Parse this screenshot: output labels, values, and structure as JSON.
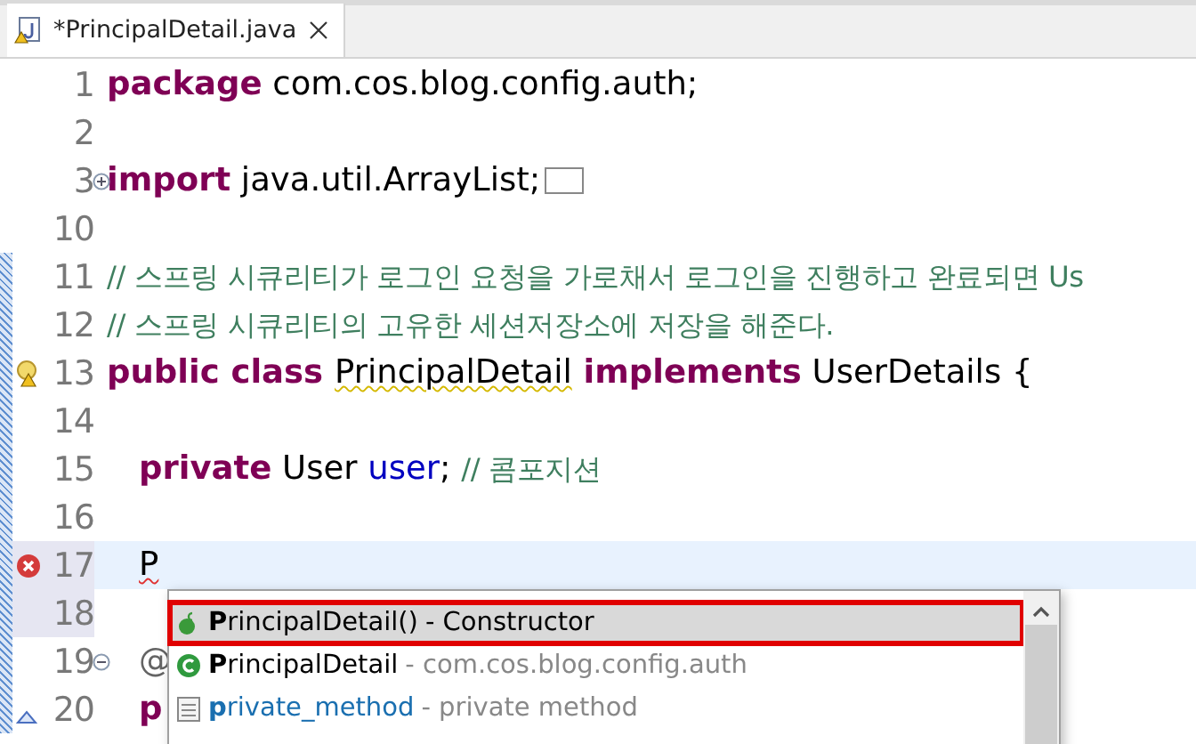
{
  "tab": {
    "title": "*PrincipalDetail.java",
    "dirty": true
  },
  "lines": [
    {
      "number": "1",
      "tokens": [
        {
          "kind": "keyword",
          "text": "package"
        },
        {
          "kind": "plain",
          "text": " com.cos.blog.config.auth;"
        }
      ]
    },
    {
      "number": "2"
    },
    {
      "number": "3",
      "fold_expanded": false,
      "tokens": [
        {
          "kind": "keyword",
          "text": "import"
        },
        {
          "kind": "plain",
          "text": " java.util.ArrayList;"
        }
      ]
    },
    {
      "number": "10"
    },
    {
      "number": "11",
      "tokens": [
        {
          "kind": "comment",
          "text": "// 스프링 시큐리티가 로그인 요청을 가로채서 로그인을 진행하고 완료되면 Us"
        }
      ]
    },
    {
      "number": "12",
      "tokens": [
        {
          "kind": "comment",
          "text": "// 스프링 시큐리티의 고유한 세션저장소에 저장을 해준다."
        }
      ]
    },
    {
      "number": "13",
      "warning": true,
      "tokens": [
        {
          "kind": "keyword",
          "text": "public class "
        },
        {
          "kind": "warning",
          "text": "PrincipalDetail"
        },
        {
          "kind": "keyword",
          "text": " implements"
        },
        {
          "kind": "plain",
          "text": " UserDetails {"
        }
      ]
    },
    {
      "number": "14"
    },
    {
      "number": "15",
      "indent": true,
      "tokens": [
        {
          "kind": "keyword",
          "text": "private"
        },
        {
          "kind": "plain",
          "text": " User "
        },
        {
          "kind": "field",
          "text": "user"
        },
        {
          "kind": "plain",
          "text": "; "
        },
        {
          "kind": "comment",
          "text": "// 콤포지션"
        }
      ]
    },
    {
      "number": "16"
    },
    {
      "number": "17",
      "error": true,
      "current": true,
      "indent": true,
      "tokens": [
        {
          "kind": "error",
          "text": "P"
        }
      ]
    },
    {
      "number": "18"
    },
    {
      "number": "19",
      "fold_expanded": true,
      "indent": true,
      "tokens": [
        {
          "kind": "annotation",
          "text": "@"
        }
      ]
    },
    {
      "number": "20",
      "occurrence": true,
      "indent": true,
      "tokens": [
        {
          "kind": "keyword",
          "text": "p"
        }
      ]
    }
  ],
  "completions": [
    {
      "kind": "constructor",
      "label": "**P**rincipalDetail()",
      "detail": "- Constructor",
      "selected": true
    },
    {
      "kind": "class",
      "label": "**P**rincipalDetail",
      "detail": "- com.cos.blog.config.auth",
      "selected": false
    },
    {
      "kind": "method",
      "label": "**p**rivate_method",
      "detail": "- private method",
      "selected": false
    }
  ]
}
